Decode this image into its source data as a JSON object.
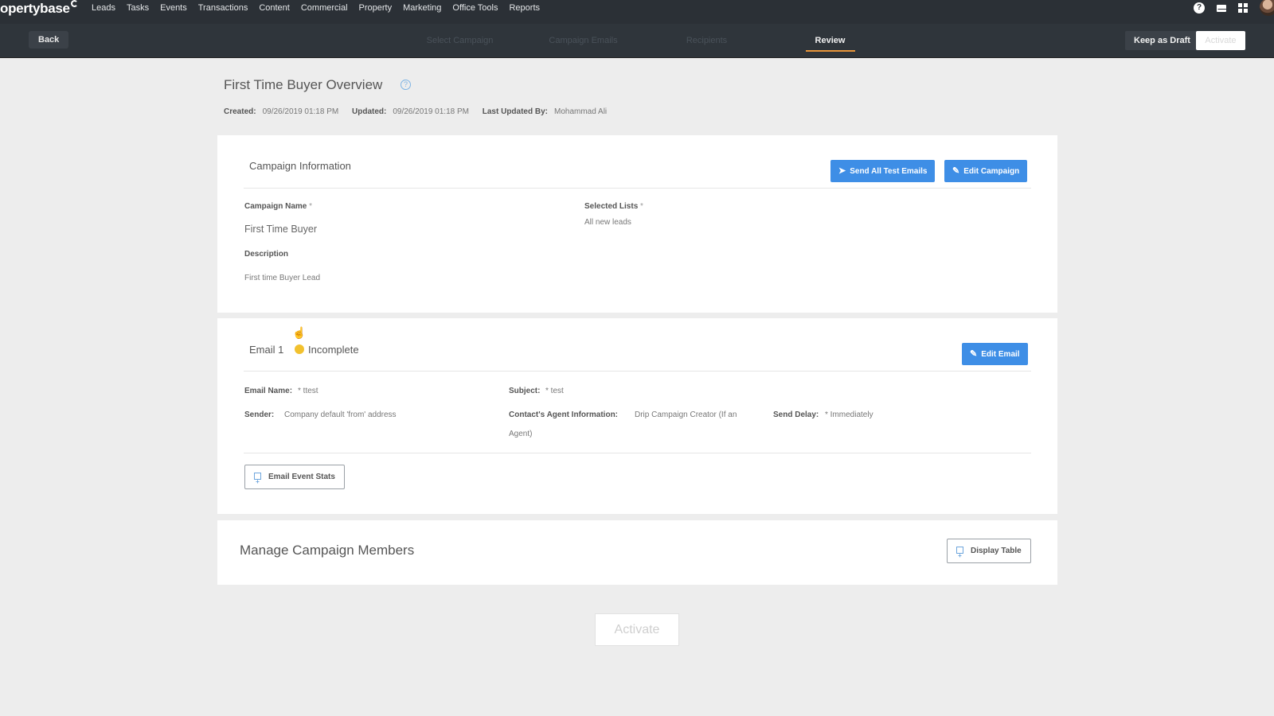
{
  "topnav": {
    "logo": "opertybase",
    "links": [
      "Leads",
      "Tasks",
      "Events",
      "Transactions",
      "Content",
      "Commercial",
      "Property",
      "Marketing",
      "Office Tools",
      "Reports"
    ]
  },
  "subbar": {
    "back_label": "Back",
    "steps": [
      "Select Campaign",
      "Campaign Emails",
      "Recipients",
      "Review"
    ],
    "keep_draft_label": "Keep as Draft",
    "activate_label": "Activate"
  },
  "page": {
    "title": "First Time Buyer Overview",
    "created_label": "Created:",
    "created_value": "09/26/2019 01:18 PM",
    "updated_label": "Updated:",
    "updated_value": "09/26/2019 01:18 PM",
    "last_updated_by_label": "Last Updated By:",
    "last_updated_by_value": "Mohammad Ali"
  },
  "campaign_info": {
    "heading": "Campaign Information",
    "send_test_label": "Send All Test Emails",
    "edit_campaign_label": "Edit Campaign",
    "campaign_name_label": "Campaign Name",
    "campaign_name_value": "First Time Buyer",
    "selected_lists_label": "Selected Lists",
    "selected_lists_value": "All new leads",
    "description_label": "Description",
    "description_value": "First time Buyer Lead",
    "required_mark": "*"
  },
  "email": {
    "heading": "Email 1",
    "status": "Incomplete",
    "status_color": "#f2c12e",
    "edit_email_label": "Edit Email",
    "email_name_label": "Email Name:",
    "email_name_value": "* ttest",
    "subject_label": "Subject:",
    "subject_value": "* test",
    "sender_label": "Sender:",
    "sender_value": "Company default 'from' address",
    "agent_info_label": "Contact's Agent Information:",
    "agent_info_value": "Drip Campaign Creator (If an",
    "agent_info_value2": "Agent)",
    "send_delay_label": "Send Delay:",
    "send_delay_value": "* Immediately",
    "event_stats_label": "Email Event Stats"
  },
  "members": {
    "heading": "Manage Campaign Members",
    "display_table_label": "Display Table"
  },
  "footer": {
    "activate_label": "Activate"
  },
  "colors": {
    "accent_blue": "#3e8ee6",
    "active_tab_underline": "#e8953a",
    "topbar": "#2b3036"
  }
}
